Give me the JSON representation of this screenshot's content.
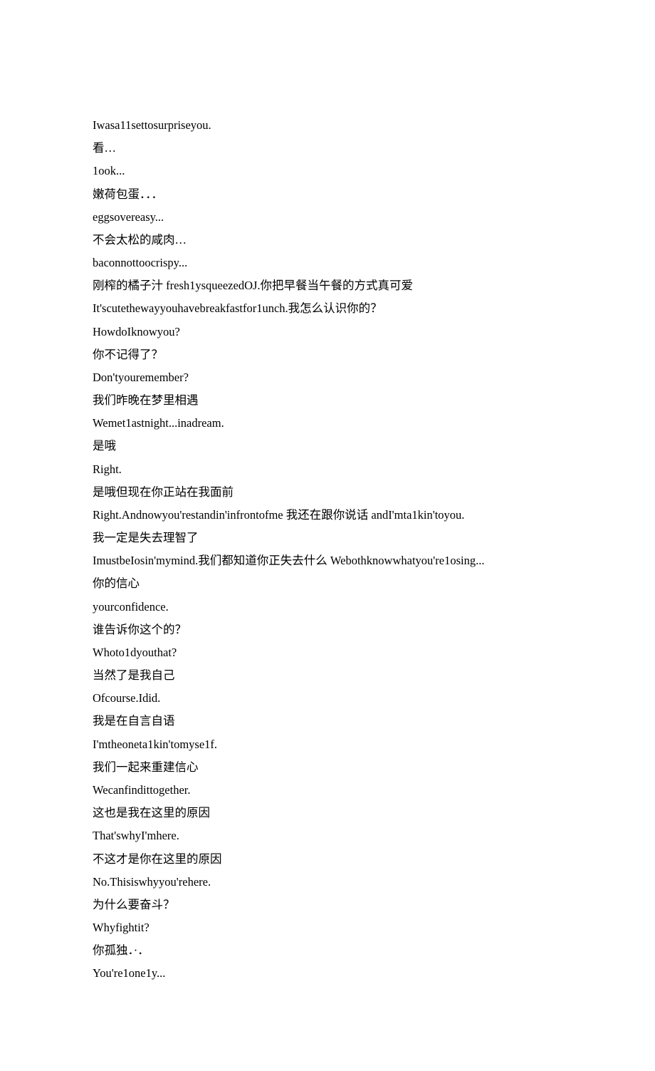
{
  "lines": [
    "Iwasa11settosurpriseyou.",
    "看…",
    "1ook...",
    "嫩荷包蛋．．．",
    "eggsovereasy...",
    "不会太松的咸肉…",
    "baconnottoocrispy...",
    "刚榨的橘子汁 fresh1ysqueezedOJ.你把早餐当午餐的方式真可爱",
    "It'scutethewayyouhavebreakfastfor1unch.我怎么认识你的？",
    "HowdoIknowyou?",
    "你不记得了？",
    "Don'tyouremember?",
    "我们昨晚在梦里相遇",
    "Wemet1astnight...inadream.",
    "是哦",
    "Right.",
    "是哦但现在你正站在我面前",
    "Right.Andnowyou'restandin'infrontofme 我还在跟你说话 andI'mta1kin'toyou.",
    "我一定是失去理智了",
    "ImustbeIosin'mymind.我们都知道你正失去什么 Webothknowwhatyou're1osing...",
    "你的信心",
    "yourconfidence.",
    "谁告诉你这个的？",
    "Whoto1dyouthat?",
    "当然了是我自己",
    "Ofcourse.Idid.",
    "我是在自言自语",
    "I'mtheoneta1kin'tomyse1f.",
    "我们一起来重建信心",
    "Wecanfindittogether.",
    "这也是我在这里的原因",
    "That'swhyI'mhere.",
    "不这才是你在这里的原因",
    "No.Thisiswhyyou'rehere.",
    "为什么要奋斗？",
    "Whyfightit?",
    "你孤独．·．",
    "You're1one1y..."
  ]
}
